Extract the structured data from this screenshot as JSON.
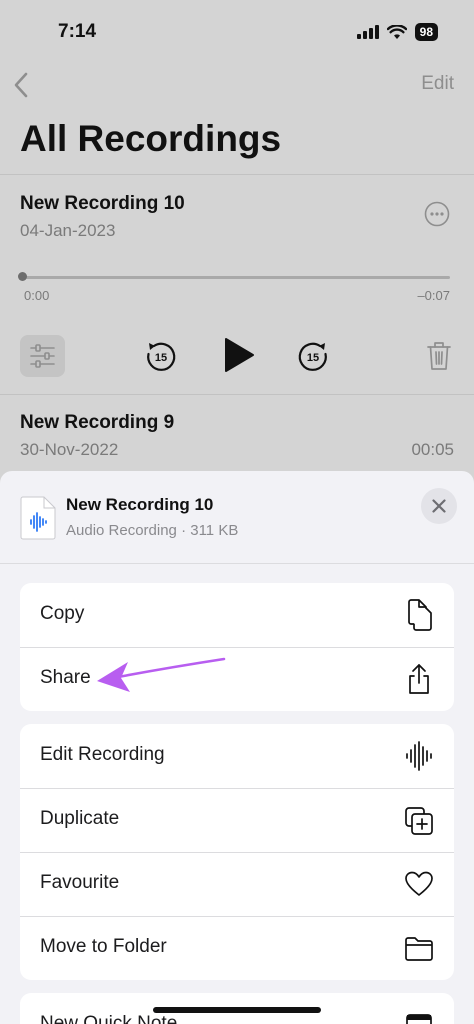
{
  "status_bar": {
    "time": "7:14",
    "battery": "98"
  },
  "nav": {
    "edit_label": "Edit"
  },
  "page": {
    "title": "All Recordings"
  },
  "recordings": [
    {
      "name": "New Recording 10",
      "date": "04-Jan-2023",
      "elapsed": "0:00",
      "remaining": "–0:07",
      "progress": 0
    },
    {
      "name": "New Recording 9",
      "date": "30-Nov-2022",
      "duration": "00:05"
    }
  ],
  "player": {
    "skip_back": "15",
    "skip_forward": "15"
  },
  "sheet": {
    "title": "New Recording 10",
    "subtitle": "Audio Recording · 311 KB",
    "group1": [
      {
        "label": "Copy",
        "icon": "copy-icon"
      },
      {
        "label": "Share",
        "icon": "share-icon"
      }
    ],
    "group2": [
      {
        "label": "Edit Recording",
        "icon": "waveform-icon"
      },
      {
        "label": "Duplicate",
        "icon": "duplicate-icon"
      },
      {
        "label": "Favourite",
        "icon": "heart-icon"
      },
      {
        "label": "Move to Folder",
        "icon": "folder-icon"
      }
    ],
    "group3": [
      {
        "label": "New Quick Note",
        "icon": "quick-note-icon"
      }
    ]
  },
  "colors": {
    "accent": "#b85ef0",
    "dim_background": "#d4d4d4",
    "sheet_background": "#f2f2f6",
    "file_icon_blue": "#2f7bf6"
  }
}
